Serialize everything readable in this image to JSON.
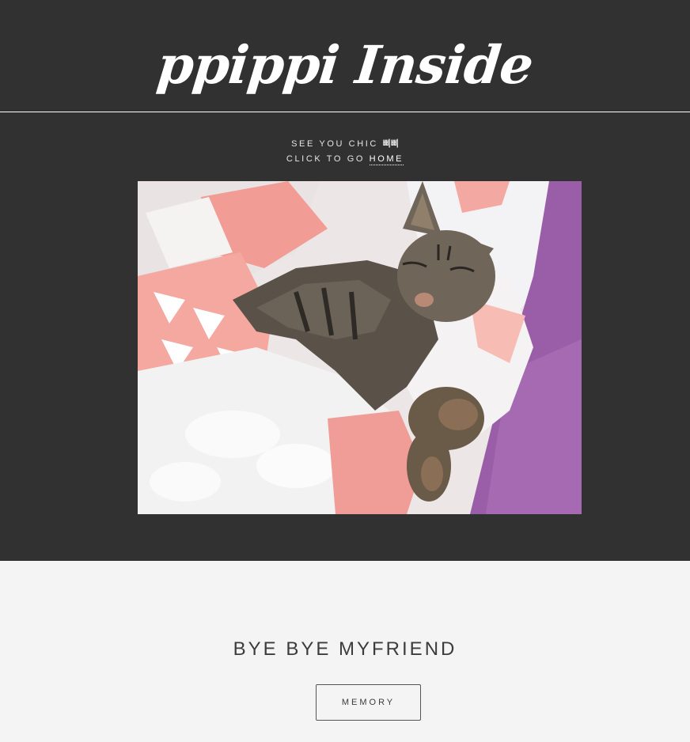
{
  "header": {
    "title": "ppippi Inside"
  },
  "tagline": {
    "line1": "SEE YOU CHIC",
    "line1_suffix": "삐삐",
    "line2_prefix": "CLICK TO GO",
    "home_link": "HOME"
  },
  "hero_image": {
    "subject": "sleeping tabby cat on blankets"
  },
  "section": {
    "title": "BYE BYE MYFRIEND",
    "button_label": "MEMORY"
  },
  "colors": {
    "header_bg": "#313131",
    "page_bg": "#f4f4f4",
    "text_light": "#ffffff",
    "text_dark": "#3c3c3c"
  }
}
